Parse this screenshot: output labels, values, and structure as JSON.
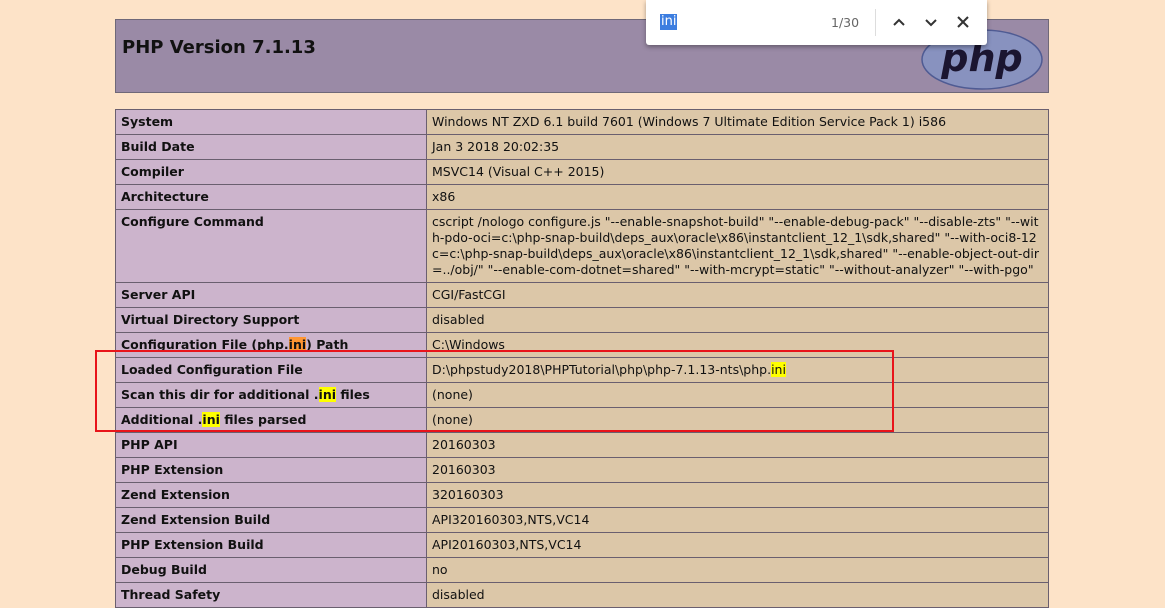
{
  "header": {
    "title": "PHP Version 7.1.13",
    "logo_text": "php"
  },
  "find_bar": {
    "query": "ini",
    "count": "1/30"
  },
  "rows": [
    {
      "key": "System",
      "value": "Windows NT ZXD 6.1 build 7601 (Windows 7 Ultimate Edition Service Pack 1) i586"
    },
    {
      "key": "Build Date",
      "value": "Jan 3 2018 20:02:35"
    },
    {
      "key": "Compiler",
      "value": "MSVC14 (Visual C++ 2015)"
    },
    {
      "key": "Architecture",
      "value": "x86"
    },
    {
      "key": "Configure Command",
      "value": "cscript /nologo configure.js \"--enable-snapshot-build\" \"--enable-debug-pack\" \"--disable-zts\" \"--with-pdo-oci=c:\\php-snap-build\\deps_aux\\oracle\\x86\\instantclient_12_1\\sdk,shared\" \"--with-oci8-12c=c:\\php-snap-build\\deps_aux\\oracle\\x86\\instantclient_12_1\\sdk,shared\" \"--enable-object-out-dir=../obj/\" \"--enable-com-dotnet=shared\" \"--with-mcrypt=static\" \"--without-analyzer\" \"--with-pgo\""
    },
    {
      "key": "Server API",
      "value": "CGI/FastCGI"
    },
    {
      "key": "Virtual Directory Support",
      "value": "disabled"
    },
    {
      "key_pre": "Configuration File (php.",
      "key_hl": "ini",
      "key_post": ") Path",
      "value": "C:\\Windows"
    },
    {
      "key": "Loaded Configuration File",
      "value_pre": "D:\\phpstudy2018\\PHPTutorial\\php\\php-7.1.13-nts\\php.",
      "value_hl": "ini"
    },
    {
      "key_pre": "Scan this dir for additional .",
      "key_hl": "ini",
      "key_post": " files",
      "value": "(none)"
    },
    {
      "key_pre": "Additional .",
      "key_hl": "ini",
      "key_post": " files parsed",
      "value": "(none)"
    },
    {
      "key": "PHP API",
      "value": "20160303"
    },
    {
      "key": "PHP Extension",
      "value": "20160303"
    },
    {
      "key": "Zend Extension",
      "value": "320160303"
    },
    {
      "key": "Zend Extension Build",
      "value": "API320160303,NTS,VC14"
    },
    {
      "key": "PHP Extension Build",
      "value": "API20160303,NTS,VC14"
    },
    {
      "key": "Debug Build",
      "value": "no"
    },
    {
      "key": "Thread Safety",
      "value": "disabled"
    }
  ]
}
